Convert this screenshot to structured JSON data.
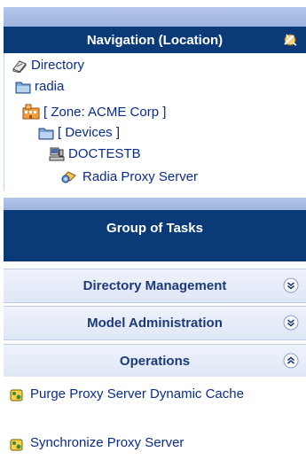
{
  "navigation": {
    "title": "Navigation (Location)",
    "tree": [
      {
        "label": "Directory",
        "icon": "directory-book-icon"
      },
      {
        "label": "radia",
        "icon": "folder-icon"
      },
      {
        "label": "[ Zone: ACME Corp ]",
        "icon": "zone-building-icon"
      },
      {
        "label": "[ Devices ]",
        "icon": "folder-icon"
      },
      {
        "label": "DOCTESTB",
        "icon": "computer-icon"
      },
      {
        "label": "Radia Proxy Server",
        "icon": "proxy-server-icon"
      }
    ]
  },
  "tasks": {
    "title": "Group of Tasks",
    "groups": [
      {
        "label": "Directory Management",
        "state": "collapsed"
      },
      {
        "label": "Model Administration",
        "state": "collapsed"
      },
      {
        "label": "Operations",
        "state": "expanded"
      }
    ],
    "operations": [
      {
        "label": "Purge Proxy Server Dynamic Cache"
      },
      {
        "label": "Synchronize Proxy Server"
      }
    ]
  },
  "colors": {
    "header_bg": "#0a3a78",
    "link": "#0a2c8a",
    "band": "#a9bde4"
  }
}
